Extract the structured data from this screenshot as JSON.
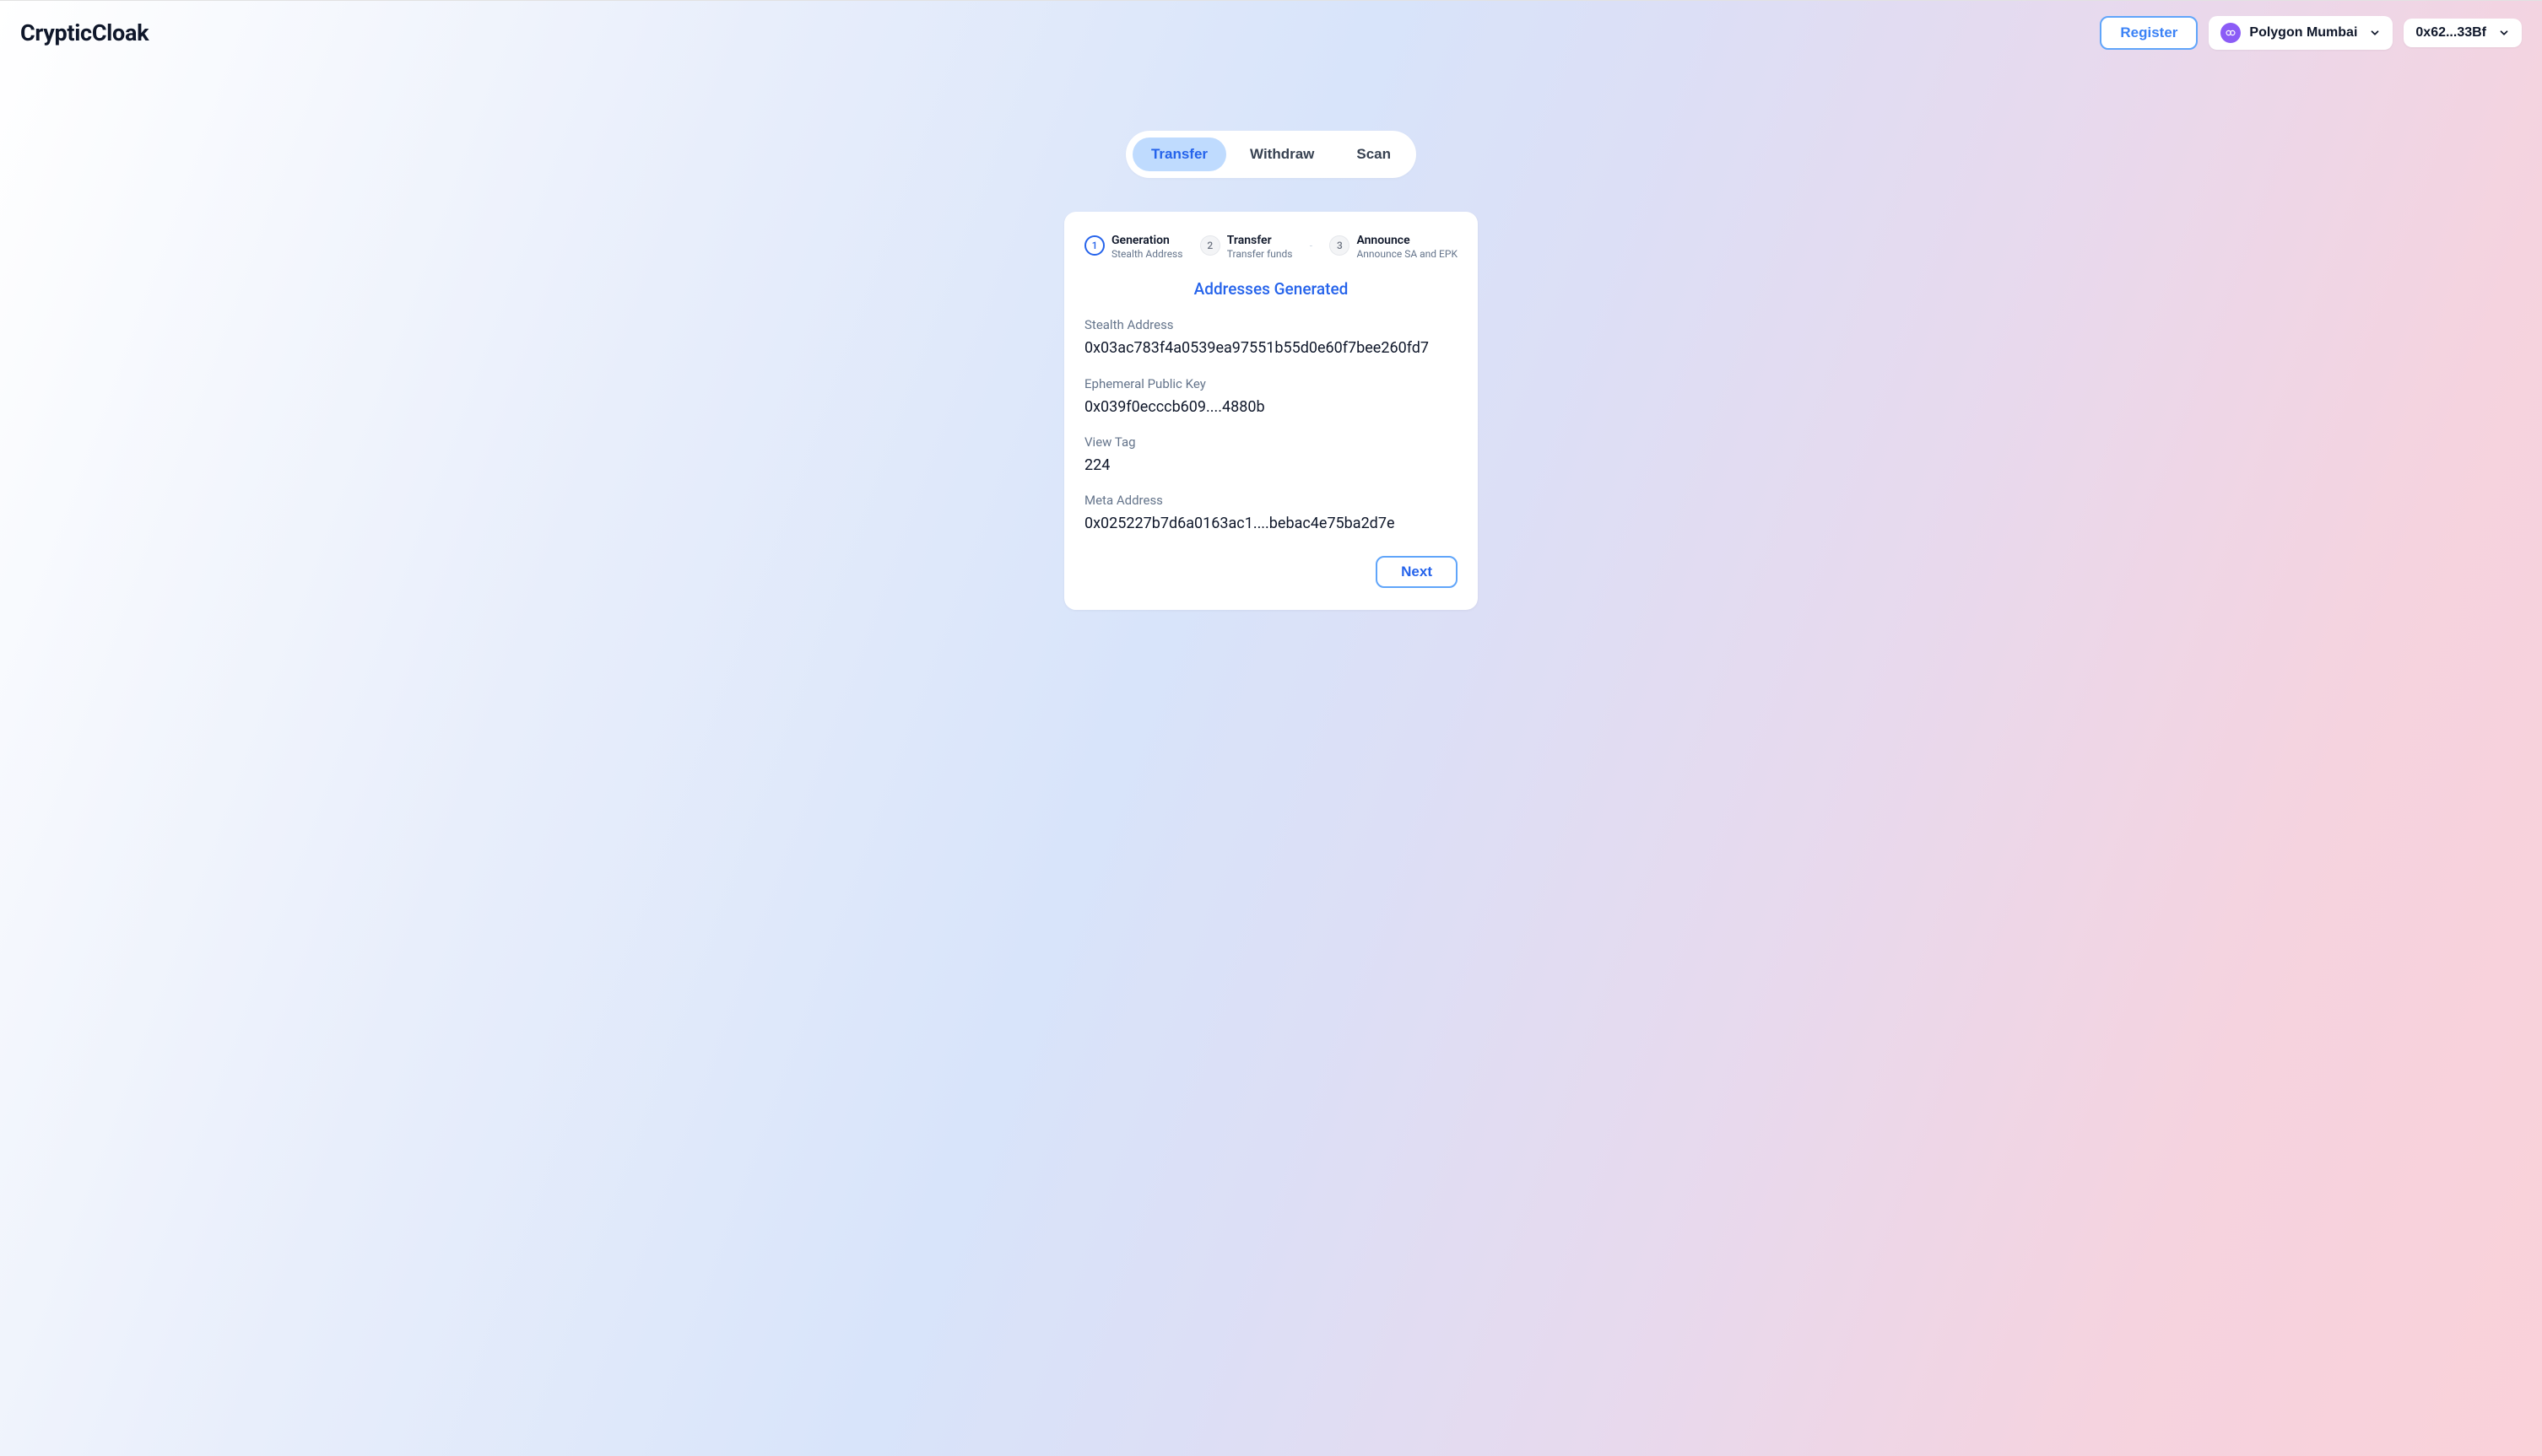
{
  "header": {
    "logo": "CrypticCloak",
    "register_label": "Register",
    "network_name": "Polygon Mumbai",
    "wallet_address": "0x62...33Bf"
  },
  "tabs": {
    "transfer": "Transfer",
    "withdraw": "Withdraw",
    "scan": "Scan"
  },
  "steps": [
    {
      "num": "1",
      "title": "Generation",
      "sub": "Stealth Address",
      "active": true
    },
    {
      "num": "2",
      "title": "Transfer",
      "sub": "Transfer funds",
      "active": false
    },
    {
      "num": "3",
      "title": "Announce",
      "sub": "Announce SA and EPK",
      "active": false
    }
  ],
  "result": {
    "heading": "Addresses Generated",
    "stealth_label": "Stealth Address",
    "stealth_value": "0x03ac783f4a0539ea97551b55d0e60f7bee260fd7",
    "epk_label": "Ephemeral Public Key",
    "epk_value": "0x039f0ecccb609....4880b",
    "viewtag_label": "View Tag",
    "viewtag_value": "224",
    "meta_label": "Meta Address",
    "meta_value": "0x025227b7d6a0163ac1....bebac4e75ba2d7e"
  },
  "actions": {
    "next": "Next"
  }
}
